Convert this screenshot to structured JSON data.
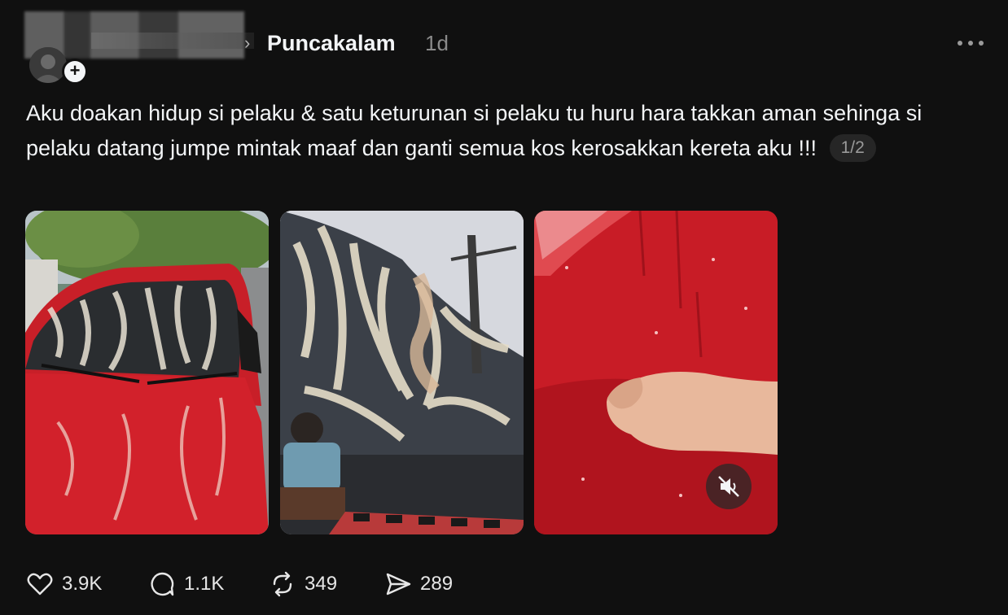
{
  "header": {
    "community": "Puncakalam",
    "time": "1d"
  },
  "post": {
    "text": "Aku doakan hidup si pelaku & satu keturunan si pelaku tu huru hara takkan aman sehinga si pelaku datang jumpe mintak maaf dan ganti semua kos kerosakkan kereta aku !!!",
    "page_indicator": "1/2"
  },
  "icons": {
    "more": "more-horizontal-icon",
    "like": "heart-icon",
    "comment": "comment-icon",
    "repost": "repost-icon",
    "share": "send-icon",
    "mute": "speaker-muted-icon"
  },
  "actions": {
    "likes": "3.9K",
    "comments": "1.1K",
    "reposts": "349",
    "shares": "289"
  },
  "colors": {
    "background": "#101010",
    "text": "#f3f5f7",
    "muted": "#8a8a8a",
    "car_red": "#d0202a"
  }
}
